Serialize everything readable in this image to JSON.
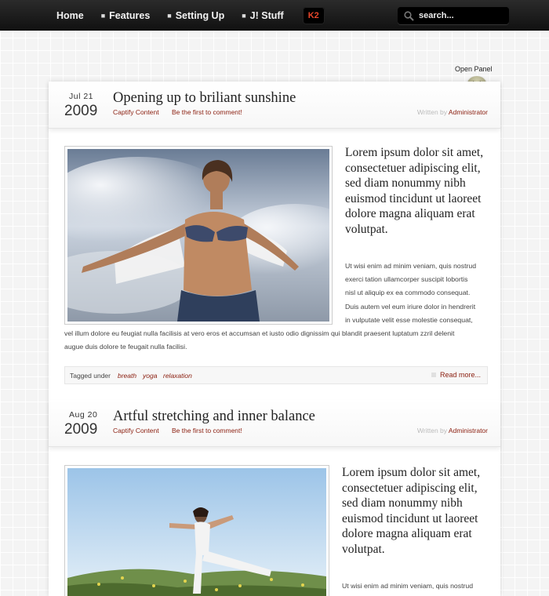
{
  "nav": {
    "items": [
      {
        "label": "Home",
        "bullet": false
      },
      {
        "label": "Features",
        "bullet": true
      },
      {
        "label": "Setting Up",
        "bullet": true
      },
      {
        "label": "J! Stuff",
        "bullet": true
      }
    ],
    "k2_label": "K2",
    "search_placeholder": "search..."
  },
  "panel": {
    "label": "Open Panel"
  },
  "posts": [
    {
      "month_day": "Jul  21",
      "year": "2009",
      "title": "Opening up to briliant sunshine",
      "category": "Captify Content",
      "comment_link": "Be the first to comment!",
      "written_by": "Written by",
      "author": "Administrator",
      "lead": "Lorem ipsum dolor sit amet, consectetuer adipiscing elit, sed diam nonummy nibh euismod tincidunt ut laoreet dolore magna aliquam erat volutpat.",
      "body_lines": [
        "Ut wisi enim ad minim veniam, quis nostrud",
        "exerci tation ullamcorper suscipit lobortis",
        "nisl ut aliquip ex ea commodo consequat.",
        "Duis autem vel eum iriure dolor in hendrerit",
        "in vulputate velit esse molestie consequat,"
      ],
      "full_lines": [
        "vel illum dolore eu feugiat nulla facilisis at vero eros et accumsan et iusto odio dignissim qui blandit praesent luptatum zzril delenit",
        "augue duis dolore te feugait nulla facilisi."
      ],
      "tagged_label": "Tagged under",
      "tags": [
        "breath",
        "yoga",
        "relaxation"
      ],
      "read_more": "Read more..."
    },
    {
      "month_day": "Aug  20",
      "year": "2009",
      "title": "Artful stretching and inner balance",
      "category": "Captify Content",
      "comment_link": "Be the first to comment!",
      "written_by": "Written by",
      "author": "Administrator",
      "lead": "Lorem ipsum dolor sit amet, consectetuer adipiscing elit, sed diam nonummy nibh euismod tincidunt ut laoreet dolore magna aliquam erat volutpat.",
      "body_lines": [
        "Ut wisi enim ad minim veniam, quis nostrud"
      ]
    }
  ],
  "colors": {
    "accent": "#8a1d0e",
    "nav_bg": "#1b1b1b"
  }
}
